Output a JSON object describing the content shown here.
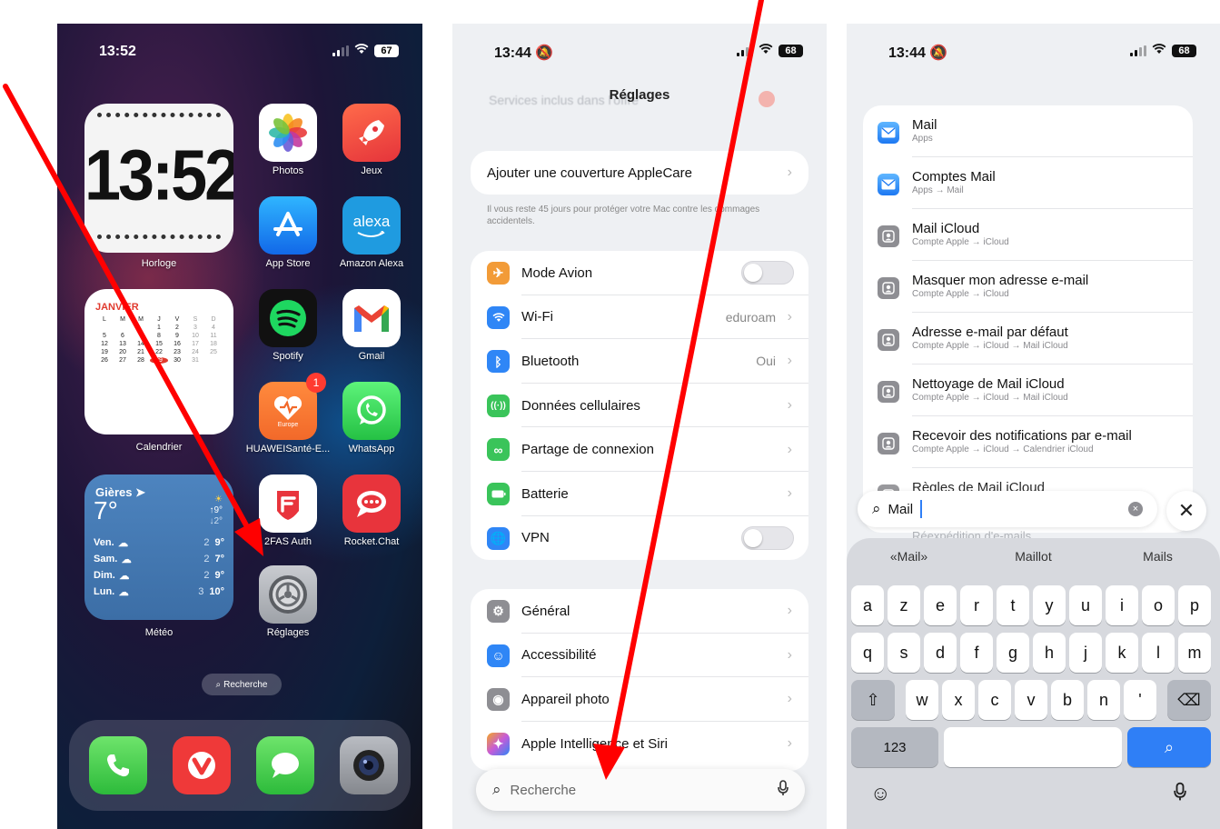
{
  "home": {
    "status": {
      "time": "13:52",
      "battery": "67"
    },
    "clock_widget": {
      "time": "13:52",
      "label": "Horloge"
    },
    "apps": [
      {
        "name": "Photos"
      },
      {
        "name": "Jeux"
      },
      {
        "name": "App Store"
      },
      {
        "name": "Amazon Alexa",
        "icon_text": "alexa"
      },
      {
        "name": "Spotify"
      },
      {
        "name": "Gmail"
      },
      {
        "name": "HUAWEISanté-E...",
        "badge": "1",
        "icon_text": "Europe"
      },
      {
        "name": "WhatsApp"
      },
      {
        "name": "2FAS Auth"
      },
      {
        "name": "Rocket.Chat"
      },
      {
        "name": "Réglages"
      }
    ],
    "calendar_widget": {
      "month": "JANVIER",
      "weekdays": [
        "L",
        "M",
        "M",
        "J",
        "V",
        "S",
        "D"
      ],
      "weeks": [
        [
          "",
          "",
          "",
          "1",
          "2",
          "3",
          "4"
        ],
        [
          "5",
          "6",
          "7",
          "8",
          "9",
          "10",
          "11"
        ],
        [
          "12",
          "13",
          "14",
          "15",
          "16",
          "17",
          "18"
        ],
        [
          "19",
          "20",
          "21",
          "22",
          "23",
          "24",
          "25"
        ],
        [
          "26",
          "27",
          "28",
          "29",
          "30",
          "31",
          ""
        ]
      ],
      "today": "29",
      "label": "Calendrier"
    },
    "weather_widget": {
      "city": "Gières",
      "temp": "7°",
      "high": "↑9°",
      "low": "↓2°",
      "days": [
        {
          "day": "Ven.",
          "lo": "2",
          "hi": "9°"
        },
        {
          "day": "Sam.",
          "lo": "2",
          "hi": "7°"
        },
        {
          "day": "Dim.",
          "lo": "2",
          "hi": "9°"
        },
        {
          "day": "Lun.",
          "lo": "3",
          "hi": "10°"
        }
      ],
      "label": "Météo"
    },
    "search_pill": "Recherche",
    "dock": [
      "phone-icon",
      "vivaldi-icon",
      "messages-icon",
      "camera-icon"
    ]
  },
  "settings": {
    "status": {
      "time": "13:44",
      "battery": "68"
    },
    "title": "Réglages",
    "ghost_row": "Services inclus dans l'offre",
    "applecare": {
      "label": "Ajouter une couverture AppleCare",
      "footnote": "Il vous reste 45 jours pour protéger votre Mac contre les dommages accidentels."
    },
    "group1": [
      {
        "label": "Mode Avion",
        "kind": "toggle",
        "color": "#f29b38"
      },
      {
        "label": "Wi-Fi",
        "value": "eduroam",
        "color": "#2f86f6"
      },
      {
        "label": "Bluetooth",
        "value": "Oui",
        "color": "#2f86f6"
      },
      {
        "label": "Données cellulaires",
        "color": "#3ac45a"
      },
      {
        "label": "Partage de connexion",
        "color": "#3ac45a"
      },
      {
        "label": "Batterie",
        "color": "#3ac45a"
      },
      {
        "label": "VPN",
        "kind": "toggle",
        "color": "#2f86f6"
      }
    ],
    "group2": [
      {
        "label": "Général",
        "color": "#8e8e93"
      },
      {
        "label": "Accessibilité",
        "color": "#2f86f6"
      },
      {
        "label": "Appareil photo",
        "color": "#8e8e93"
      },
      {
        "label": "Apple Intelligence et Siri",
        "color": "#c65bd8"
      }
    ],
    "search": {
      "placeholder": "Recherche"
    }
  },
  "search": {
    "status": {
      "time": "13:44",
      "battery": "68"
    },
    "results": [
      {
        "title": "Mail",
        "subtitle": "Apps",
        "icon": "mail-icon"
      },
      {
        "title": "Comptes Mail",
        "subtitle": "Apps → Mail",
        "icon": "mail-icon"
      },
      {
        "title": "Mail iCloud",
        "subtitle": "Compte Apple → iCloud",
        "icon": "apple-account-icon"
      },
      {
        "title": "Masquer mon adresse e-mail",
        "subtitle": "Compte Apple → iCloud",
        "icon": "apple-account-icon"
      },
      {
        "title": "Adresse e-mail par défaut",
        "subtitle": "Compte Apple → iCloud → Mail iCloud",
        "icon": "apple-account-icon"
      },
      {
        "title": "Nettoyage de Mail iCloud",
        "subtitle": "Compte Apple → iCloud → Mail iCloud",
        "icon": "apple-account-icon"
      },
      {
        "title": "Recevoir des notifications par e-mail",
        "subtitle": "Compte Apple → iCloud → Calendrier iCloud",
        "icon": "apple-account-icon"
      },
      {
        "title": "Règles de Mail iCloud",
        "subtitle": "",
        "icon": "apple-account-icon"
      },
      {
        "title": "Réexpédition d'e-mails",
        "subtitle": "",
        "icon": "apple-account-icon"
      }
    ],
    "query": "Mail",
    "suggestions": [
      "«Mail»",
      "Maillot",
      "Mails"
    ],
    "keyboard": {
      "row1": [
        "a",
        "z",
        "e",
        "r",
        "t",
        "y",
        "u",
        "i",
        "o",
        "p"
      ],
      "row2": [
        "q",
        "s",
        "d",
        "f",
        "g",
        "h",
        "j",
        "k",
        "l",
        "m"
      ],
      "row3": [
        "w",
        "x",
        "c",
        "v",
        "b",
        "n",
        "'"
      ],
      "numbers_key": "123",
      "shift_icon": "shift-icon",
      "delete_icon": "delete-icon",
      "search_icon": "search-icon",
      "emoji_icon": "emoji-icon",
      "mic_icon": "mic-icon"
    }
  },
  "annotations": {
    "arrow_color": "#ff0000"
  }
}
